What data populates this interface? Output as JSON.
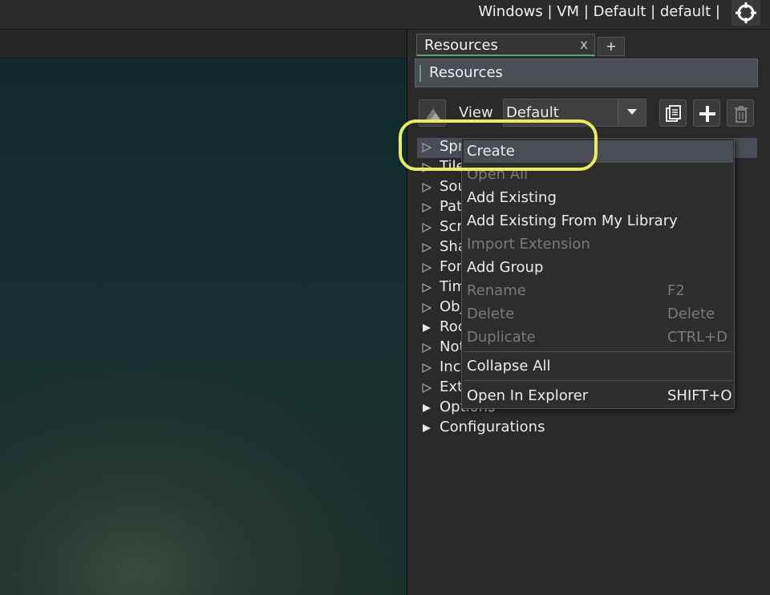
{
  "topbar": {
    "target_text": "Windows | VM | Default | default |",
    "target_icon": "crosshair-icon"
  },
  "tabs": [
    {
      "label": "Resources",
      "close": "x"
    }
  ],
  "tab_add": "+",
  "panel": {
    "title": "Resources"
  },
  "view": {
    "label": "View",
    "selected": "Default"
  },
  "tree": [
    {
      "label": "Sprites",
      "expanded": false
    },
    {
      "label": "Tile Sets",
      "expanded": false
    },
    {
      "label": "Sounds",
      "expanded": false
    },
    {
      "label": "Paths",
      "expanded": false
    },
    {
      "label": "Scripts",
      "expanded": false
    },
    {
      "label": "Shaders",
      "expanded": false
    },
    {
      "label": "Fonts",
      "expanded": false
    },
    {
      "label": "Timelines",
      "expanded": false
    },
    {
      "label": "Objects",
      "expanded": false
    },
    {
      "label": "Rooms",
      "expanded": true
    },
    {
      "label": "Notes",
      "expanded": false
    },
    {
      "label": "Included Files",
      "expanded": false
    },
    {
      "label": "Extensions",
      "expanded": false
    },
    {
      "label": "Options",
      "expanded": true
    },
    {
      "label": "Configurations",
      "expanded": true
    }
  ],
  "context_menu": [
    {
      "label": "Create",
      "shortcut": "",
      "enabled": true
    },
    {
      "label": "Open All",
      "shortcut": "",
      "enabled": false
    },
    {
      "label": "Add Existing",
      "shortcut": "",
      "enabled": true
    },
    {
      "label": "Add Existing From My Library",
      "shortcut": "",
      "enabled": true
    },
    {
      "label": "Import Extension",
      "shortcut": "",
      "enabled": false
    },
    {
      "label": "Add Group",
      "shortcut": "",
      "enabled": true
    },
    {
      "label": "Rename",
      "shortcut": "F2",
      "enabled": false
    },
    {
      "label": "Delete",
      "shortcut": "Delete",
      "enabled": false
    },
    {
      "label": "Duplicate",
      "shortcut": "CTRL+D",
      "enabled": false
    },
    {
      "label": "Collapse All",
      "shortcut": "",
      "enabled": true
    },
    {
      "label": "Open In Explorer",
      "shortcut": "SHIFT+O",
      "enabled": true
    }
  ],
  "colors": {
    "accent": "#5fa37a",
    "highlight_ring": "#ecec5f",
    "selection": "#4a4d55"
  }
}
